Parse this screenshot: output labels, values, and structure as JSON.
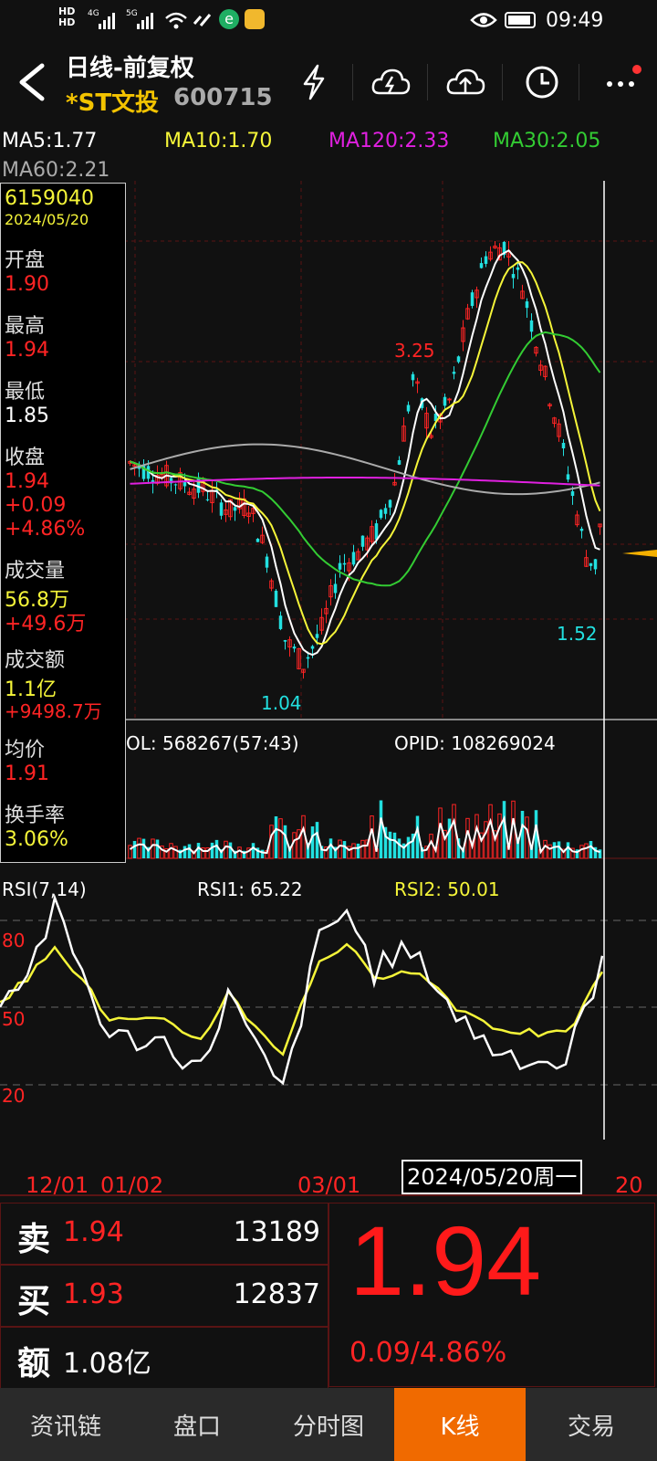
{
  "status_bar": {
    "net1": "HD",
    "net1_sub": "4G",
    "net2": "HD",
    "net2_sub": "5G",
    "time": "09:49"
  },
  "header": {
    "title": "日线-前复权",
    "stock_name": "*ST文投",
    "stock_code": "600715"
  },
  "ma": {
    "ma5": "MA5:1.77",
    "ma10": "MA10:1.70",
    "ma120": "MA120:2.33",
    "ma30": "MA30:2.05",
    "ma60": "MA60:2.21"
  },
  "info": {
    "id": "6159040",
    "date": "2024/05/20",
    "open_label": "开盘",
    "open": "1.90",
    "high_label": "最高",
    "high": "1.94",
    "low_label": "最低",
    "low": "1.85",
    "close_label": "收盘",
    "close": "1.94",
    "change": "+0.09",
    "change_pct": "+4.86%",
    "volume_label": "成交量",
    "volume": "56.8万",
    "volume_change": "+49.6万",
    "amount_label": "成交额",
    "amount": "1.1亿",
    "amount_change": "+9498.7万",
    "avg_label": "均价",
    "avg": "1.91",
    "turnover_label": "换手率",
    "turnover": "3.06%"
  },
  "chart_labels": {
    "high_mark": "3.25",
    "low_mark": "1.04",
    "recent_low": "1.52",
    "vol_title": "OL: 568267(57:43)",
    "opid": "OPID: 108269024",
    "rsi_title": "RSI(7,14)",
    "rsi1": "RSI1: 65.22",
    "rsi2": "RSI2: 50.01",
    "rsi_80": "80",
    "rsi_50": "50",
    "rsi_20": "20"
  },
  "axis": {
    "date1": "12/01",
    "date2": "01/02",
    "date3": "03/01",
    "cursor_date": "2024/05/20周一",
    "date_end": "20"
  },
  "quote": {
    "sell_label": "卖",
    "sell_price": "1.94",
    "sell_vol": "13189",
    "buy_label": "买",
    "buy_price": "1.93",
    "buy_vol": "12837",
    "amount_label": "额",
    "amount_value": "1.08亿",
    "price": "1.94",
    "change": "0.09/4.86%"
  },
  "tabs": [
    {
      "label": "资讯链"
    },
    {
      "label": "盘口"
    },
    {
      "label": "分时图"
    },
    {
      "label": "K线"
    },
    {
      "label": "交易"
    }
  ],
  "colors": {
    "up": "#ff2424",
    "down": "#22e0e0",
    "ma5": "#ffffff",
    "ma10": "#f5f539",
    "ma30": "#33cc33",
    "ma60": "#aaaaaa",
    "ma120": "#e020e0",
    "accent": "#f06a00"
  }
}
